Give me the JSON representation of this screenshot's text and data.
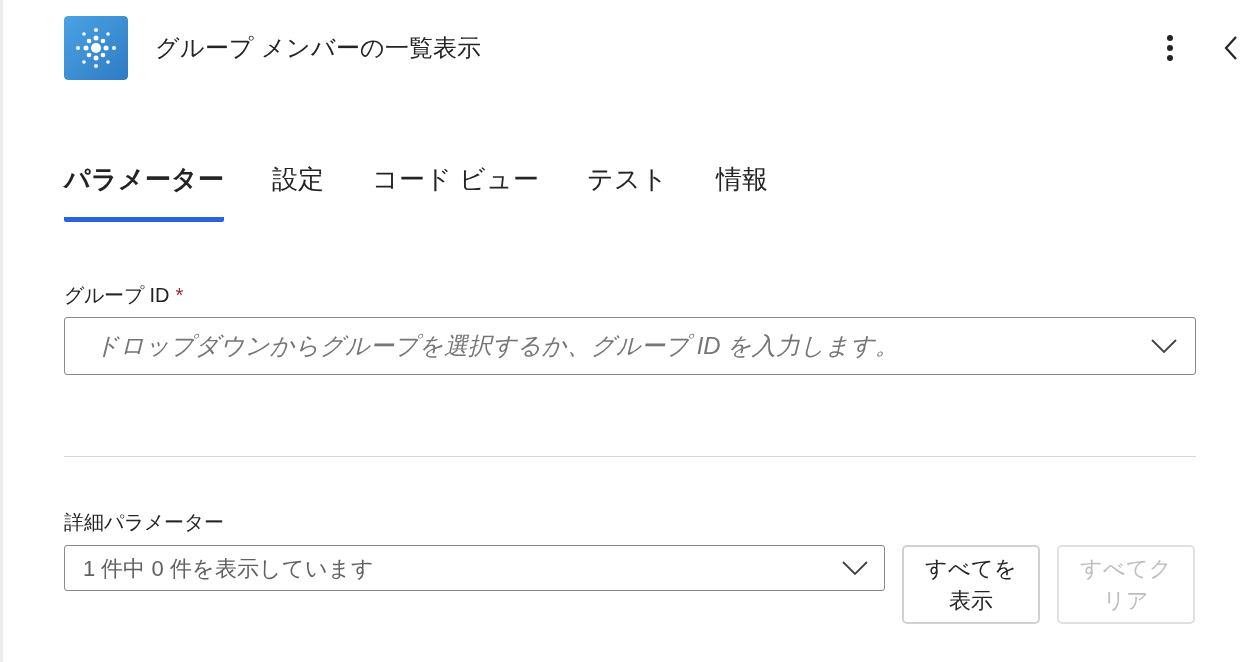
{
  "header": {
    "title": "グループ メンバーの一覧表示"
  },
  "tabs": [
    {
      "label": "パラメーター",
      "selected": true
    },
    {
      "label": "設定",
      "selected": false
    },
    {
      "label": "コード ビュー",
      "selected": false
    },
    {
      "label": "テスト",
      "selected": false
    },
    {
      "label": "情報",
      "selected": false
    }
  ],
  "group_id": {
    "label": "グループ ID",
    "required_mark": "*",
    "placeholder": "ドロップダウンからグループを選択するか、グループ ID を入力します。"
  },
  "advanced": {
    "label": "詳細パラメーター",
    "value": "1 件中 0 件を表示しています",
    "buttons": [
      {
        "label": "すべてを表示",
        "disabled": false
      },
      {
        "label": "すべてクリア",
        "disabled": true
      }
    ]
  }
}
